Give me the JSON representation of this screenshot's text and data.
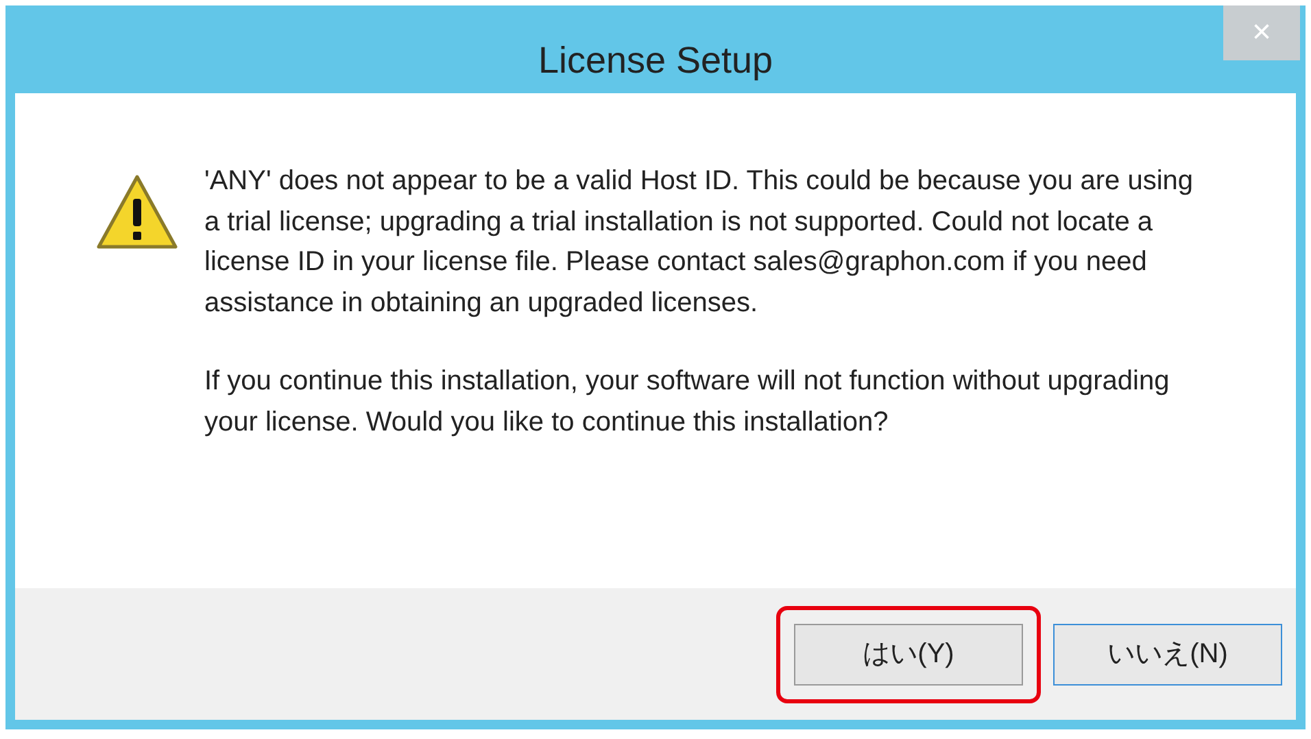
{
  "window": {
    "title": "License Setup",
    "close": "×"
  },
  "message": {
    "paragraphs": [
      "'ANY' does not appear to be a valid Host ID.  This could be because you are using a trial license; upgrading a trial installation is not supported. Could not locate a license ID in your license file. Please contact sales@graphon.com if you need assistance in obtaining an upgraded licenses.",
      "If you continue this installation, your software will not function without upgrading your license. Would you like to continue this installation?"
    ]
  },
  "buttons": [
    {
      "label": "はい(Y)",
      "highlighted": true
    },
    {
      "label": "いいえ(N)",
      "highlighted": false
    }
  ]
}
